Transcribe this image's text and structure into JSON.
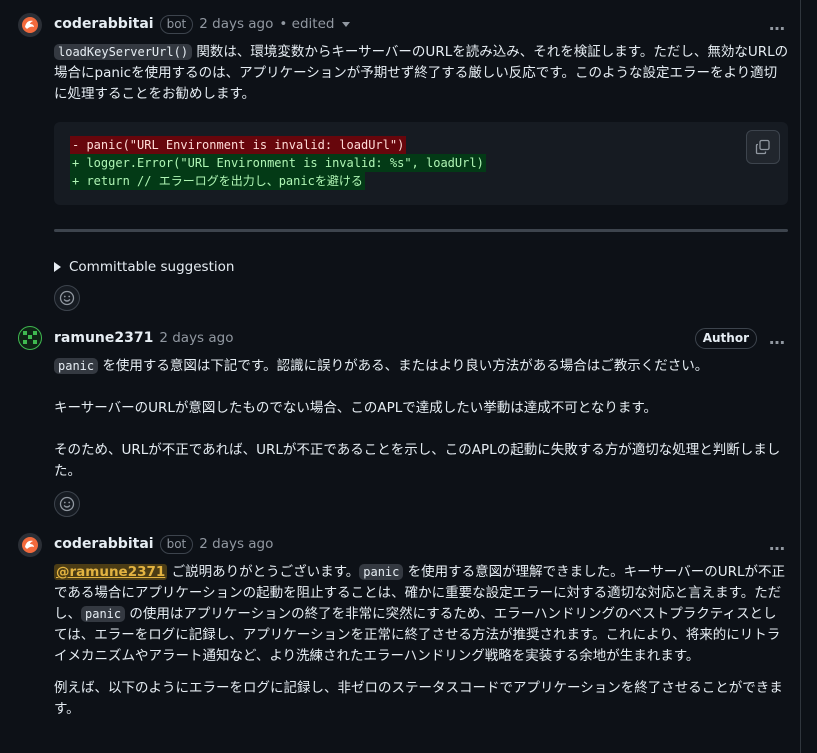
{
  "comments": [
    {
      "author": "coderabbitai",
      "badge": "bot",
      "time": "2 days ago",
      "edited": "• edited",
      "body_code": "loadKeyServerUrl()",
      "body_text": " 関数は、環境変数からキーサーバーのURLを読み込み、それを検証します。ただし、無効なURLの場合にpanicを使用するのは、アプリケーションが予期せず終了する厳しい反応です。このような設定エラーをより適切に処理することをお勧めします。",
      "code_lines": [
        {
          "type": "del",
          "text": "- panic(\"URL Environment is invalid: loadUrl\")"
        },
        {
          "type": "add",
          "text": "+ logger.Error(\"URL Environment is invalid: %s\", loadUrl)"
        },
        {
          "type": "add",
          "text": "+ return // エラーログを出力し、panicを避ける"
        }
      ],
      "summary": "Committable suggestion"
    },
    {
      "author": "ramune2371",
      "time": "2 days ago",
      "author_badge": "Author",
      "p1_code": "panic",
      "p1_text": " を使用する意図は下記です。認識に誤りがある、またはより良い方法がある場合はご教示ください。",
      "p2": "キーサーバーのURLが意図したものでない場合、このAPLで達成したい挙動は達成不可となります。",
      "p3": "そのため、URLが不正であれば、URLが不正であることを示し、このAPLの起動に失敗する方が適切な処理と判断しました。"
    },
    {
      "author": "coderabbitai",
      "badge": "bot",
      "time": "2 days ago",
      "mention": "@ramune2371",
      "t1": " ご説明ありがとうございます。",
      "c1": "panic",
      "t2": " を使用する意図が理解できました。キーサーバーのURLが不正である場合にアプリケーションの起動を阻止することは、確かに重要な設定エラーに対する適切な対応と言えます。ただし、",
      "c2": "panic",
      "t3": " の使用はアプリケーションの終了を非常に突然にするため、エラーハンドリングのベストプラクティスとしては、エラーをログに記録し、アプリケーションを正常に終了させる方法が推奨されます。これにより、将来的にリトライメカニズムやアラート通知など、より洗練されたエラーハンドリング戦略を実装する余地が生まれます。",
      "p2": "例えば、以下のようにエラーをログに記録し、非ゼロのステータスコードでアプリケーションを終了させることができます。"
    }
  ],
  "icons": {
    "kebab": "…",
    "smiley": "smiley-icon",
    "copy": "copy-icon"
  }
}
